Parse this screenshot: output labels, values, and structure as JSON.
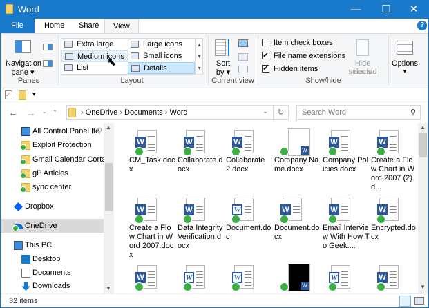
{
  "window": {
    "title": "Word",
    "min": "—",
    "max": "☐",
    "close": "✕"
  },
  "tabs": [
    {
      "label": "File"
    },
    {
      "label": "Home"
    },
    {
      "label": "Share"
    },
    {
      "label": "View"
    }
  ],
  "help": "?",
  "ribbon": {
    "panes": {
      "nav_label1": "Navigation",
      "nav_label2": "pane ▾",
      "group": "Panes"
    },
    "layout": {
      "items": [
        "Extra large icons",
        "Large icons",
        "Medium icons",
        "Small icons",
        "List",
        "Details"
      ],
      "group": "Layout"
    },
    "current_view": {
      "sort1": "Sort",
      "sort2": "by ▾",
      "group": "Current view"
    },
    "show_hide": {
      "item_check_boxes": "Item check boxes",
      "file_name_extensions": "File name extensions",
      "hidden_items": "Hidden items",
      "item_check_boxes_checked": false,
      "file_name_extensions_checked": true,
      "hidden_items_checked": true,
      "hide_selected1": "Hide selected",
      "hide_selected2": "items",
      "group": "Show/hide"
    },
    "options": {
      "label": "Options",
      "arrow": "▾"
    }
  },
  "address": {
    "crumbs": [
      "OneDrive",
      "Documents",
      "Word"
    ],
    "search_placeholder": "Search Word"
  },
  "nav": [
    {
      "label": "All Control Panel Ite",
      "type": "cp",
      "indent": true
    },
    {
      "label": "Exploit Protection",
      "type": "folder",
      "indent": true
    },
    {
      "label": "Gmail Calendar Cortan",
      "type": "folder",
      "indent": true
    },
    {
      "label": "gP Articles",
      "type": "folder",
      "indent": true
    },
    {
      "label": "sync center",
      "type": "folder",
      "indent": true
    },
    {
      "label": "Dropbox",
      "type": "dropbox",
      "indent": false
    },
    {
      "label": "OneDrive",
      "type": "onedrive",
      "indent": false,
      "selected": true
    },
    {
      "label": "This PC",
      "type": "pc",
      "indent": false
    },
    {
      "label": "Desktop",
      "type": "desktop",
      "indent": true
    },
    {
      "label": "Documents",
      "type": "docs",
      "indent": true
    },
    {
      "label": "Downloads",
      "type": "down",
      "indent": true
    }
  ],
  "files": [
    {
      "name": "CM_Task.docx"
    },
    {
      "name": "Collaborate.docx"
    },
    {
      "name": "Collaborate 2.docx"
    },
    {
      "name": "Company Name.docx",
      "thumb": "white"
    },
    {
      "name": "Company Policies.docx"
    },
    {
      "name": "Create a Flow Chart in Word 2007 (2).d..."
    },
    {
      "name": "Create a Flow Chart in Word 2007.docx"
    },
    {
      "name": "Data Integrity Verification.docx"
    },
    {
      "name": "Document.doc",
      "old": true
    },
    {
      "name": "Document.docx"
    },
    {
      "name": "Email Interview With How To Geek...."
    },
    {
      "name": "Encrypted.docx"
    },
    {
      "name": ""
    },
    {
      "name": "",
      "old": true
    },
    {
      "name": "",
      "old": true
    },
    {
      "name": "",
      "thumb": "black"
    },
    {
      "name": "",
      "old": true
    },
    {
      "name": ""
    }
  ],
  "status": {
    "count": "32 items"
  }
}
